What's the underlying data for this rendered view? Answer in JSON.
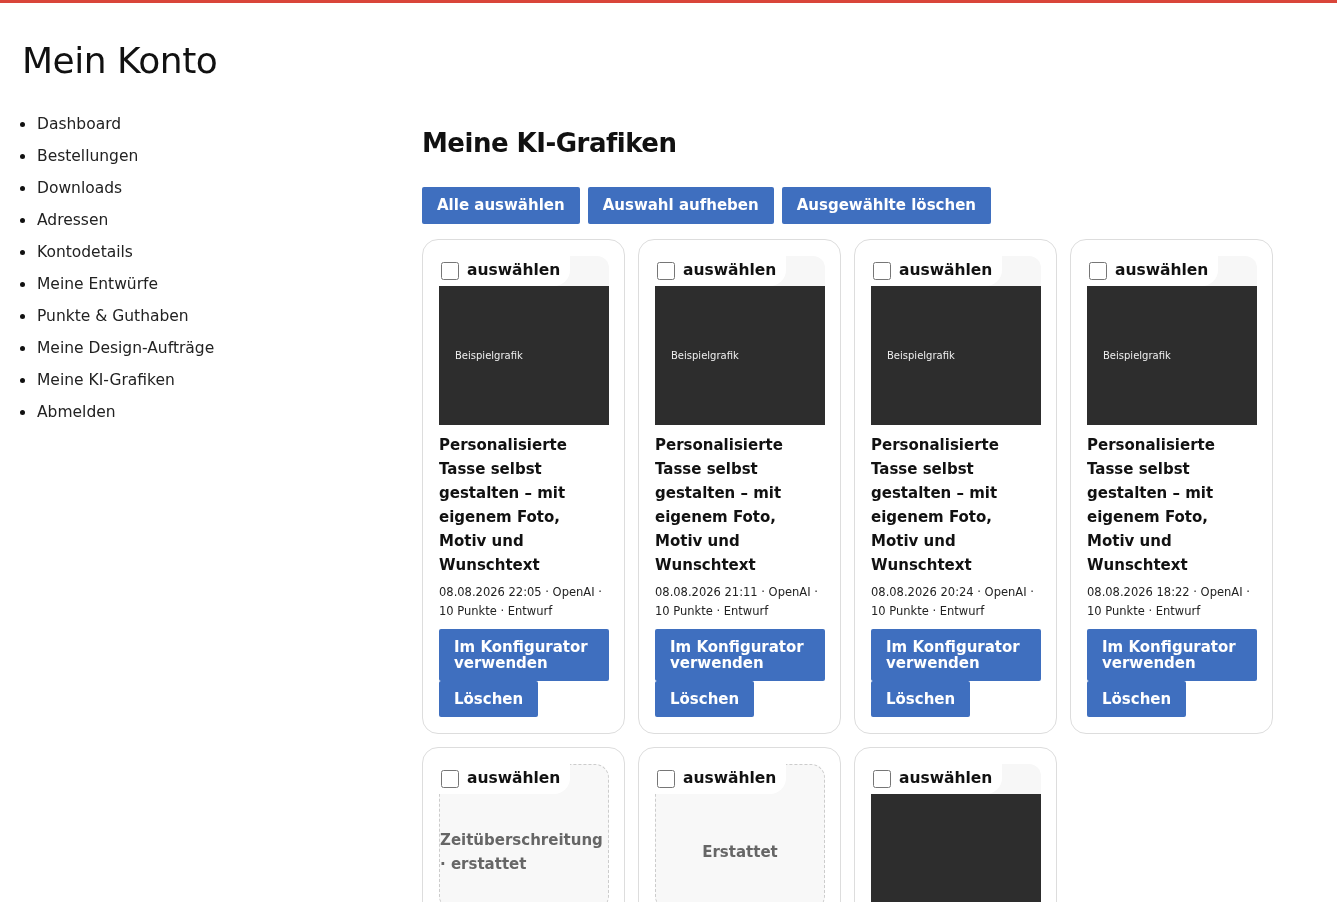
{
  "page_title": "Mein Konto",
  "nav": [
    {
      "label": "Dashboard"
    },
    {
      "label": "Bestellungen"
    },
    {
      "label": "Downloads"
    },
    {
      "label": "Adressen"
    },
    {
      "label": "Kontodetails"
    },
    {
      "label": "Meine Entwürfe"
    },
    {
      "label": "Punkte & Guthaben"
    },
    {
      "label": "Meine Design-Aufträge"
    },
    {
      "label": "Meine KI-Grafiken"
    },
    {
      "label": "Abmelden"
    }
  ],
  "section_title": "Meine KI-Grafiken",
  "bulk_actions": [
    "Alle auswählen",
    "Auswahl aufheben",
    "Ausgewählte löschen"
  ],
  "cards": [
    {
      "kind": "image",
      "select_label": "auswählen",
      "checked": false,
      "image_label": "Beispielgrafik",
      "title": "Personalisierte Tasse selbst gestalten – mit eigenem Foto, Motiv und Wunschtext",
      "meta": "08.08.2026 22:05 · OpenAI · 10 Punkte · Entwurf",
      "actions": [
        "Im Konfigurator verwenden",
        "Löschen"
      ]
    },
    {
      "kind": "image",
      "select_label": "auswählen",
      "checked": false,
      "image_label": "Beispielgrafik",
      "title": "Personalisierte Tasse selbst gestalten – mit eigenem Foto, Motiv und Wunschtext",
      "meta": "08.08.2026 21:11 · OpenAI · 10 Punkte · Entwurf",
      "actions": [
        "Im Konfigurator verwenden",
        "Löschen"
      ]
    },
    {
      "kind": "image",
      "select_label": "auswählen",
      "checked": false,
      "image_label": "Beispielgrafik",
      "title": "Personalisierte Tasse selbst gestalten – mit eigenem Foto, Motiv und Wunschtext",
      "meta": "08.08.2026 20:24 · OpenAI · 10 Punkte · Entwurf",
      "actions": [
        "Im Konfigurator verwenden",
        "Löschen"
      ]
    },
    {
      "kind": "image",
      "select_label": "auswählen",
      "checked": false,
      "image_label": "Beispielgrafik",
      "title": "Personalisierte Tasse selbst gestalten – mit eigenem Foto, Motiv und Wunschtext",
      "meta": "08.08.2026 18:22 · OpenAI · 10 Punkte · Entwurf",
      "actions": [
        "Im Konfigurator verwenden",
        "Löschen"
      ]
    },
    {
      "kind": "placeholder",
      "select_label": "auswählen",
      "checked": false,
      "status": "Zeitüberschreitung · erstattet"
    },
    {
      "kind": "placeholder",
      "select_label": "auswählen",
      "checked": false,
      "status": "Erstattet"
    },
    {
      "kind": "blank",
      "select_label": "auswählen",
      "checked": false
    }
  ]
}
